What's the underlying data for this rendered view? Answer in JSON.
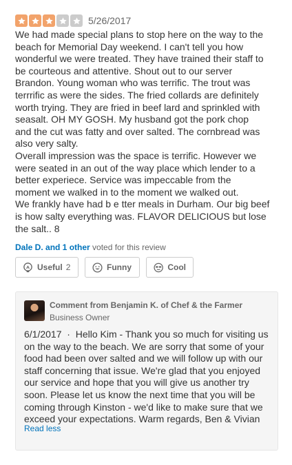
{
  "review": {
    "rating": 3,
    "max_rating": 5,
    "star_color": "#f2a36b",
    "star_empty_color": "#cccccc",
    "date": "5/26/2017",
    "lines": [
      "We had made special plans to stop here on the way to the",
      "beach for Memorial Day weekend. I can't tell you how",
      "wonderful we were treated. They have trained their staff to",
      "be  courteous and attentive. Shout out to our server",
      "Brandon. Young woman who was terrific.  The trout was",
      "terrrific as were the sides. The fried collards are definitely",
      "worth trying. They are fried in beef lard and sprinkled with",
      "seasalt. OH MY GOSH. My husband got the pork chop",
      "and the cut was fatty and over salted. The cornbread was",
      "also very salty.",
      "Overall impression was the space is terrific. However we",
      "were seated in an out of the way place which lender to a",
      "better experiece. Service was impeccable from the",
      "moment we walked in to the moment we walked out.",
      "We frankly have had b e tter meals in Durham. Our big beef",
      "is how salty everything was. FLAVOR DELICIOUS  but lose",
      "the salt.. 8"
    ]
  },
  "votes": {
    "voters": "Dale D. and 1 other",
    "suffix": " voted for this review"
  },
  "buttons": {
    "useful_label": "Useful",
    "useful_count": "2",
    "funny_label": "Funny",
    "cool_label": "Cool"
  },
  "owner_comment": {
    "header": "Comment from Benjamin K. of Chef & the Farmer",
    "role": "Business Owner",
    "date": "6/1/2017",
    "separator": "  ·  ",
    "lines": [
      "Hello Kim - Thank you so much for visiting us",
      "on the way to the beach. We are sorry that some of your",
      "food had been over salted and we will follow up with our",
      "staff concerning that issue. We're glad that you enjoyed",
      "our service and hope that you will give us another try",
      "soon. Please let us know the next time that you will be",
      "coming through Kinston - we'd like to make sure that we",
      "exceed your expectations.  Warm regards, Ben & Vivian"
    ],
    "read_less": "Read less"
  }
}
